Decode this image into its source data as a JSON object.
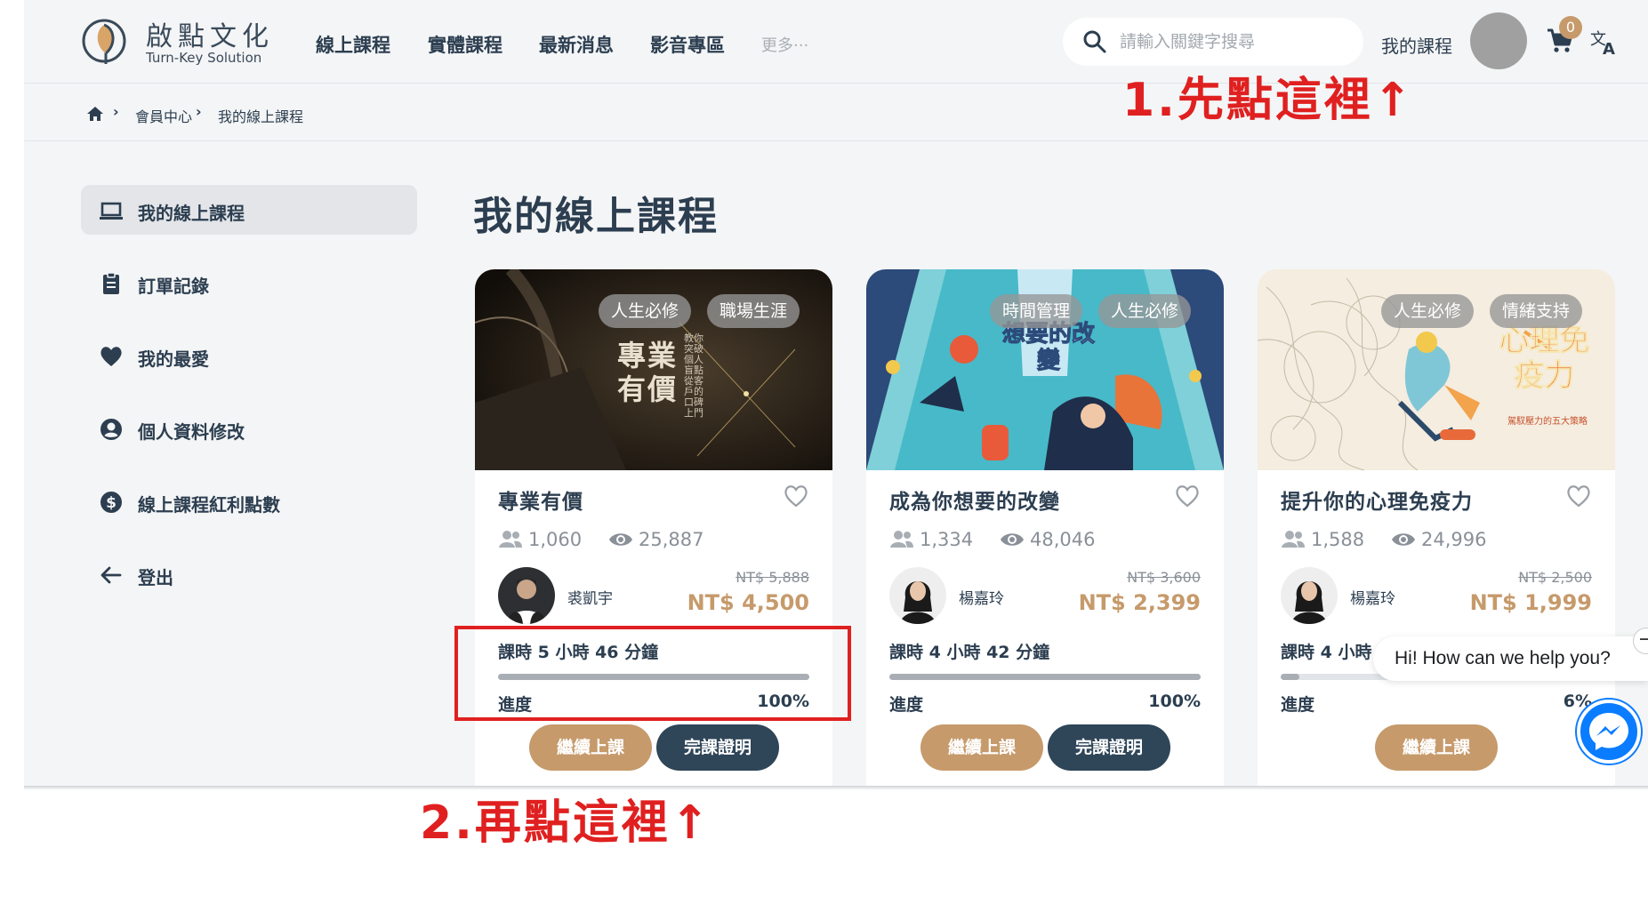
{
  "header": {
    "logo_title": "啟點文化",
    "logo_subtitle": "Turn-Key Solution",
    "nav": [
      "線上課程",
      "實體課程",
      "最新消息",
      "影音專區"
    ],
    "nav_more": "更多···",
    "search_placeholder": "請輸入關鍵字搜尋",
    "my_courses_link": "我的課程",
    "cart_count": "0"
  },
  "breadcrumb": [
    "會員中心",
    "我的線上課程"
  ],
  "sidebar": {
    "items": [
      {
        "label": "我的線上課程",
        "icon": "laptop-icon",
        "active": true
      },
      {
        "label": "訂單記錄",
        "icon": "clipboard-icon"
      },
      {
        "label": "我的最愛",
        "icon": "heart-icon"
      },
      {
        "label": "個人資料修改",
        "icon": "account-circle-icon"
      },
      {
        "label": "線上課程紅利點數",
        "icon": "dollar-circle-icon"
      },
      {
        "label": "登出",
        "icon": "arrow-left-icon"
      }
    ]
  },
  "page_title": "我的線上課程",
  "courses": [
    {
      "tags": [
        "人生必修",
        "職場生涯"
      ],
      "cover_title": "專業有價",
      "cover_subtitle": "教你突破個人盲點 從客戶的口碑上門",
      "title": "專業有價",
      "students": "1,060",
      "views": "25,887",
      "teacher": "裘凱宇",
      "old_price": "NT$ 5,888",
      "price": "NT$ 4,500",
      "duration": "課時 5 小時 46 分鐘",
      "progress_label": "進度",
      "progress": "100%",
      "progress_fraction": 1.0,
      "buttons": [
        "繼續上課",
        "完課證明"
      ]
    },
    {
      "tags": [
        "時間管理",
        "人生必修"
      ],
      "cover_title": "想要的改變",
      "title": "成為你想要的改變",
      "students": "1,334",
      "views": "48,046",
      "teacher": "楊嘉玲",
      "old_price": "NT$ 3,600",
      "price": "NT$ 2,399",
      "duration": "課時 4 小時 42 分鐘",
      "progress_label": "進度",
      "progress": "100%",
      "progress_fraction": 1.0,
      "buttons": [
        "繼續上課",
        "完課證明"
      ]
    },
    {
      "tags": [
        "人生必修",
        "情緒支持"
      ],
      "cover_title": "心理免疫力",
      "cover_subtitle": "駕馭壓力的五大策略",
      "title": "提升你的心理免疫力",
      "students": "1,588",
      "views": "24,996",
      "teacher": "楊嘉玲",
      "old_price": "NT$ 2,500",
      "price": "NT$ 1,999",
      "duration": "課時 4 小時",
      "progress_label": "進度",
      "progress": "6%",
      "progress_fraction": 0.06,
      "buttons": [
        "繼續上課"
      ]
    }
  ],
  "chat": {
    "greeting": "Hi! How can we help you?",
    "close": "−"
  },
  "annotations": {
    "step1": "1.先點這裡↑",
    "step2": "2.再點這裡↑"
  },
  "colors": {
    "accent": "#c69a6b",
    "dark_button": "#2f4558",
    "annotation_red": "#e02020",
    "messenger_blue": "#0a7cff"
  }
}
